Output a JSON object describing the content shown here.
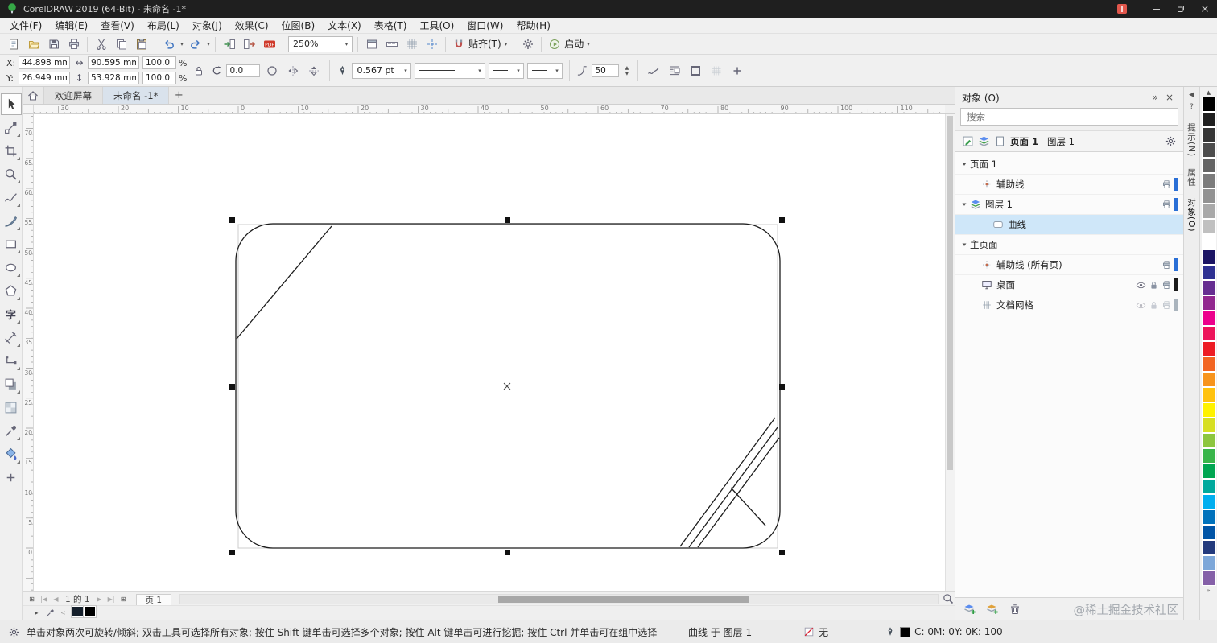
{
  "app": {
    "title": "CorelDRAW 2019 (64-Bit) - 未命名 -1*"
  },
  "menu": {
    "items": [
      "文件(F)",
      "编辑(E)",
      "查看(V)",
      "布局(L)",
      "对象(J)",
      "效果(C)",
      "位图(B)",
      "文本(X)",
      "表格(T)",
      "工具(O)",
      "窗口(W)",
      "帮助(H)"
    ]
  },
  "toolbar": {
    "zoom": "250%",
    "snap": "贴齐(T)",
    "launch": "启动"
  },
  "propbar": {
    "x_label": "X:",
    "y_label": "Y:",
    "x": "44.898 mm",
    "y": "26.949 mm",
    "w": "90.595 mm",
    "h": "53.928 mm",
    "sx": "100.0",
    "sy": "100.0",
    "pct": "%",
    "angle": "0.0",
    "outline": "0.567 pt",
    "corner": "50"
  },
  "tabs": {
    "welcome": "欢迎屏幕",
    "doc": "未命名 -1*",
    "new_tab": "+"
  },
  "rulers": {
    "h_labels": [
      "30",
      "20",
      "10",
      "0",
      "10",
      "20",
      "30",
      "40",
      "50",
      "60",
      "70",
      "80",
      "90",
      "100",
      "110"
    ],
    "v_labels": [
      "70",
      "65",
      "60",
      "55",
      "50",
      "45",
      "40",
      "35",
      "30",
      "25",
      "20",
      "15",
      "10",
      "5",
      "0"
    ]
  },
  "toolbox": [
    {
      "name": "pick-tool",
      "icon": "pick",
      "selected": true
    },
    {
      "name": "shape-tool",
      "icon": "shape",
      "flyout": true
    },
    {
      "name": "crop-tool",
      "icon": "crop",
      "flyout": true
    },
    {
      "name": "zoom-tool",
      "icon": "zoom",
      "flyout": true
    },
    {
      "name": "freehand-tool",
      "icon": "freehand",
      "flyout": true
    },
    {
      "name": "artistic-media-tool",
      "icon": "media",
      "flyout": true
    },
    {
      "name": "rectangle-tool",
      "icon": "recttool",
      "flyout": true
    },
    {
      "name": "ellipse-tool",
      "icon": "ellipsetool",
      "flyout": true
    },
    {
      "name": "polygon-tool",
      "icon": "polygon",
      "flyout": true
    },
    {
      "name": "text-tool",
      "glyph": "字",
      "flyout": true
    },
    {
      "name": "dimension-tool",
      "icon": "dimension",
      "flyout": true
    },
    {
      "name": "connector-tool",
      "icon": "connector",
      "flyout": true
    },
    {
      "name": "shadow-tool",
      "icon": "shadow",
      "flyout": true
    },
    {
      "name": "transparency-tool",
      "icon": "transparency"
    },
    {
      "name": "eyedropper-tool",
      "icon": "eyedropper",
      "flyout": true
    },
    {
      "name": "interactive-fill-tool",
      "icon": "filltool",
      "flyout": true
    },
    {
      "name": "more-tools-button",
      "icon": "plus"
    }
  ],
  "docker": {
    "title": "对象 (O)",
    "search_placeholder": "搜索",
    "page_label": "页面 1",
    "layer_label": "图层 1",
    "tree": [
      {
        "id": "page-1",
        "label": "页面 1",
        "indent": 0,
        "toggle": true
      },
      {
        "id": "guides",
        "label": "辅助线",
        "indent": 1,
        "icon": "guides",
        "print": true,
        "bar": "#2a6fd6"
      },
      {
        "id": "layer-1",
        "label": "图层 1",
        "indent": 0,
        "toggle": true,
        "icon": "layers",
        "print": true,
        "bar": "#2a6fd6"
      },
      {
        "id": "curve",
        "label": "曲线",
        "indent": 2,
        "icon": "curveobj",
        "selected": true
      },
      {
        "id": "master-page",
        "label": "主页面",
        "indent": 0,
        "toggle": true
      },
      {
        "id": "guides-all",
        "label": "辅助线 (所有页)",
        "indent": 1,
        "icon": "guides",
        "print": true,
        "bar": "#2a6fd6"
      },
      {
        "id": "desktop",
        "label": "桌面",
        "indent": 1,
        "icon": "desktop",
        "eye": true,
        "lock": true,
        "print": true,
        "bar": "#1a1a1a"
      },
      {
        "id": "document-grid",
        "label": "文档网格",
        "indent": 1,
        "icon": "gridsmall",
        "eye": true,
        "lock": true,
        "print": true,
        "bar": "#aab4bd",
        "dim": true
      }
    ]
  },
  "side_tabs": [
    {
      "id": "hints",
      "label": "提示(N)"
    },
    {
      "id": "properties",
      "label": "属性"
    },
    {
      "id": "objects",
      "label": "对象(O)",
      "active": true
    }
  ],
  "palette": {
    "colors": [
      "#000000",
      "#1f1f1f",
      "#363636",
      "#4d4d4d",
      "#646464",
      "#7b7b7b",
      "#929292",
      "#a9a9a9",
      "#c0c0c0",
      "#ffffff",
      "#1b1464",
      "#2e3192",
      "#662d91",
      "#92278f",
      "#ec008c",
      "#ed145b",
      "#ed1c24",
      "#f26522",
      "#f7941d",
      "#ffc20e",
      "#fff200",
      "#d7df23",
      "#8dc63f",
      "#39b54a",
      "#00a651",
      "#00a99d",
      "#00aeef",
      "#0072bc",
      "#0054a6",
      "#233a7d",
      "#7da7d9",
      "#8560a8"
    ]
  },
  "doc_palette": {
    "colors": [
      "#16202c",
      "#000000"
    ]
  },
  "pagebar": {
    "page_info": "1 的 1",
    "page_tab": "页 1"
  },
  "statusbar": {
    "hint": "单击对象两次可旋转/倾斜; 双击工具可选择所有对象; 按住 Shift 键单击可选择多个对象; 按住 Alt 键单击可进行挖掘; 按住 Ctrl 并单击可在组中选择",
    "object_info": "曲线 于 图层 1",
    "fill_none": "无",
    "color_info": "C: 0M: 0Y: 0K: 100"
  },
  "watermark": "@稀土掘金技术社区"
}
